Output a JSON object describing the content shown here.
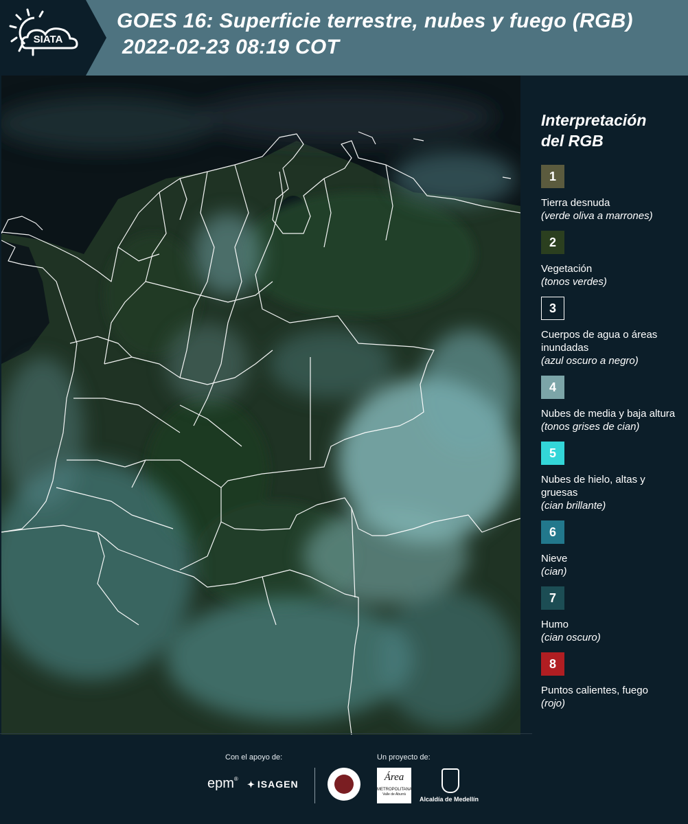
{
  "header": {
    "title_line1": "GOES 16: Superficie terrestre, nubes y fuego (RGB)",
    "title_line2": "2022-02-23 08:19 COT",
    "logo_text": "SIATA"
  },
  "legend": {
    "title_line1": "Interpretación",
    "title_line2": "del RGB",
    "items": [
      {
        "number": "1",
        "color": "#5b5b3e",
        "border": "none",
        "label": "Tierra desnuda",
        "desc": "(verde oliva a marrones)"
      },
      {
        "number": "2",
        "color": "#2b3f1f",
        "border": "none",
        "label": "Vegetación",
        "desc": "(tonos verdes)"
      },
      {
        "number": "3",
        "color": "#0c1e29",
        "border": "#ffffff",
        "label": "Cuerpos de agua o áreas inundadas",
        "desc": "(azul oscuro a negro)"
      },
      {
        "number": "4",
        "color": "#7ca5a8",
        "border": "none",
        "label": "Nubes de media y baja altura",
        "desc": "(tonos grises de cian)"
      },
      {
        "number": "5",
        "color": "#33d6d8",
        "border": "none",
        "label": "Nubes de hielo, altas y gruesas",
        "desc": "(cian brillante)"
      },
      {
        "number": "6",
        "color": "#22788c",
        "border": "none",
        "label": "Nieve",
        "desc": "(cian)"
      },
      {
        "number": "7",
        "color": "#1c4d54",
        "border": "none",
        "label": "Humo",
        "desc": "(cian oscuro)"
      },
      {
        "number": "8",
        "color": "#b01e22",
        "border": "none",
        "label": "Puntos calientes, fuego",
        "desc": "(rojo)"
      }
    ]
  },
  "footer": {
    "support_caption": "Con el apoyo de:",
    "project_caption": "Un proyecto de:",
    "epm": "epm",
    "isagen": "ISAGEN",
    "area_line1": "Área",
    "area_line2": "METROPOLITANA",
    "area_line3": "Valle de Aburrá",
    "alcaldia": "Alcaldía de Medellín"
  }
}
